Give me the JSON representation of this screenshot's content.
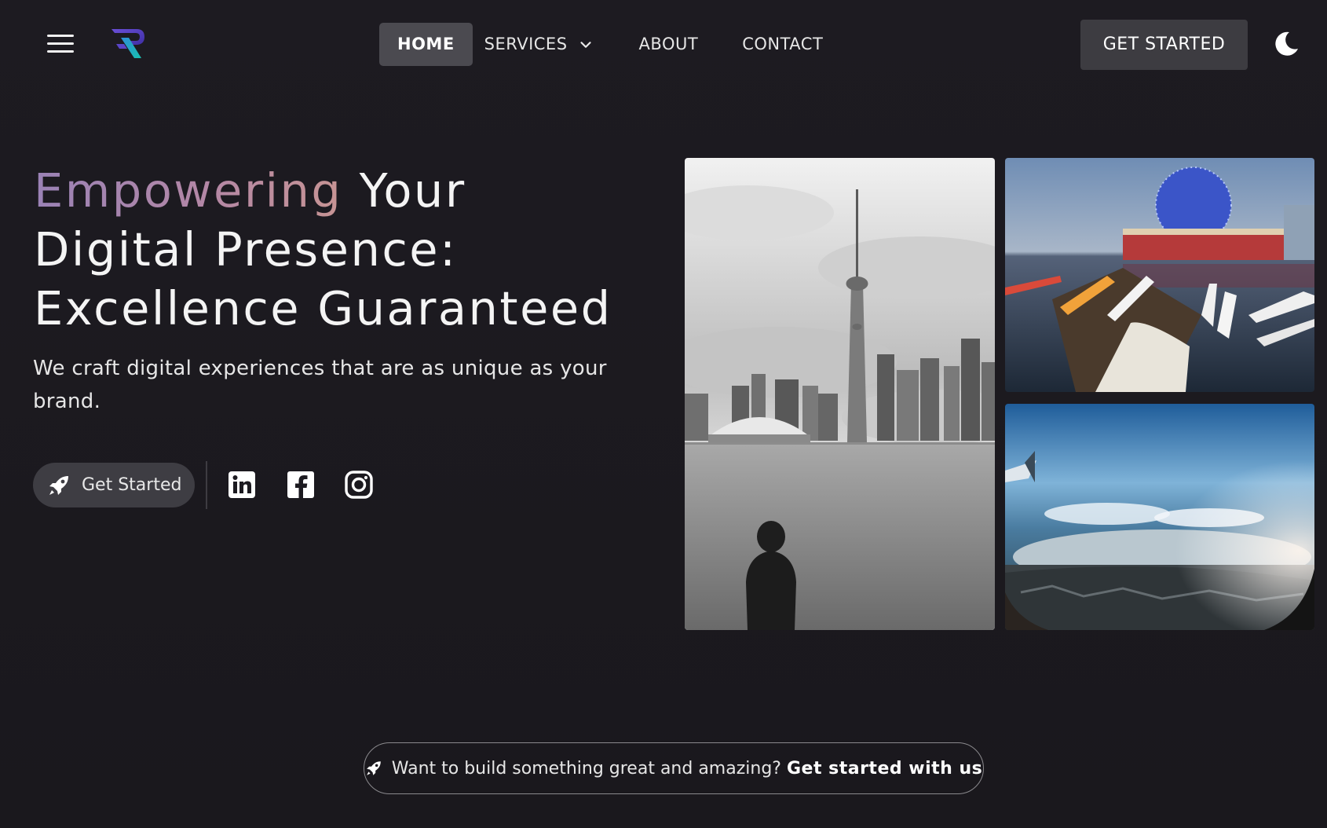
{
  "header": {
    "menu_icon": "hamburger-menu-icon",
    "logo_icon": "r-logo-icon",
    "nav": {
      "home": "HOME",
      "services": "SERVICES",
      "about": "ABOUT",
      "contact": "CONTACT"
    },
    "cta_label": "GET STARTED",
    "theme_icon": "moon-icon"
  },
  "hero": {
    "title_highlight": "Empowering",
    "title_rest_1": "Your",
    "title_line_2": "Digital Presence:",
    "title_line_3": "Excellence Guaranteed",
    "subtitle": "We craft digital experiences that are as unique as your brand.",
    "cta_label": "Get Started",
    "cta_icon": "rocket-icon",
    "social": [
      "linkedin-icon",
      "facebook-icon",
      "instagram-icon"
    ]
  },
  "gallery": {
    "images": [
      "toronto-skyline-bw-photo",
      "marina-with-boats-photo",
      "aerial-city-from-plane-photo"
    ]
  },
  "banner": {
    "icon": "rocket-icon",
    "text": "Want to build something great and amazing?",
    "link": "Get started with us"
  },
  "colors": {
    "background": "#1c1a20",
    "nav_active_bg": "#4b4a50",
    "button_bg": "#3e3d43",
    "gradient_start": "#9a82b6",
    "gradient_end": "#c79494"
  }
}
